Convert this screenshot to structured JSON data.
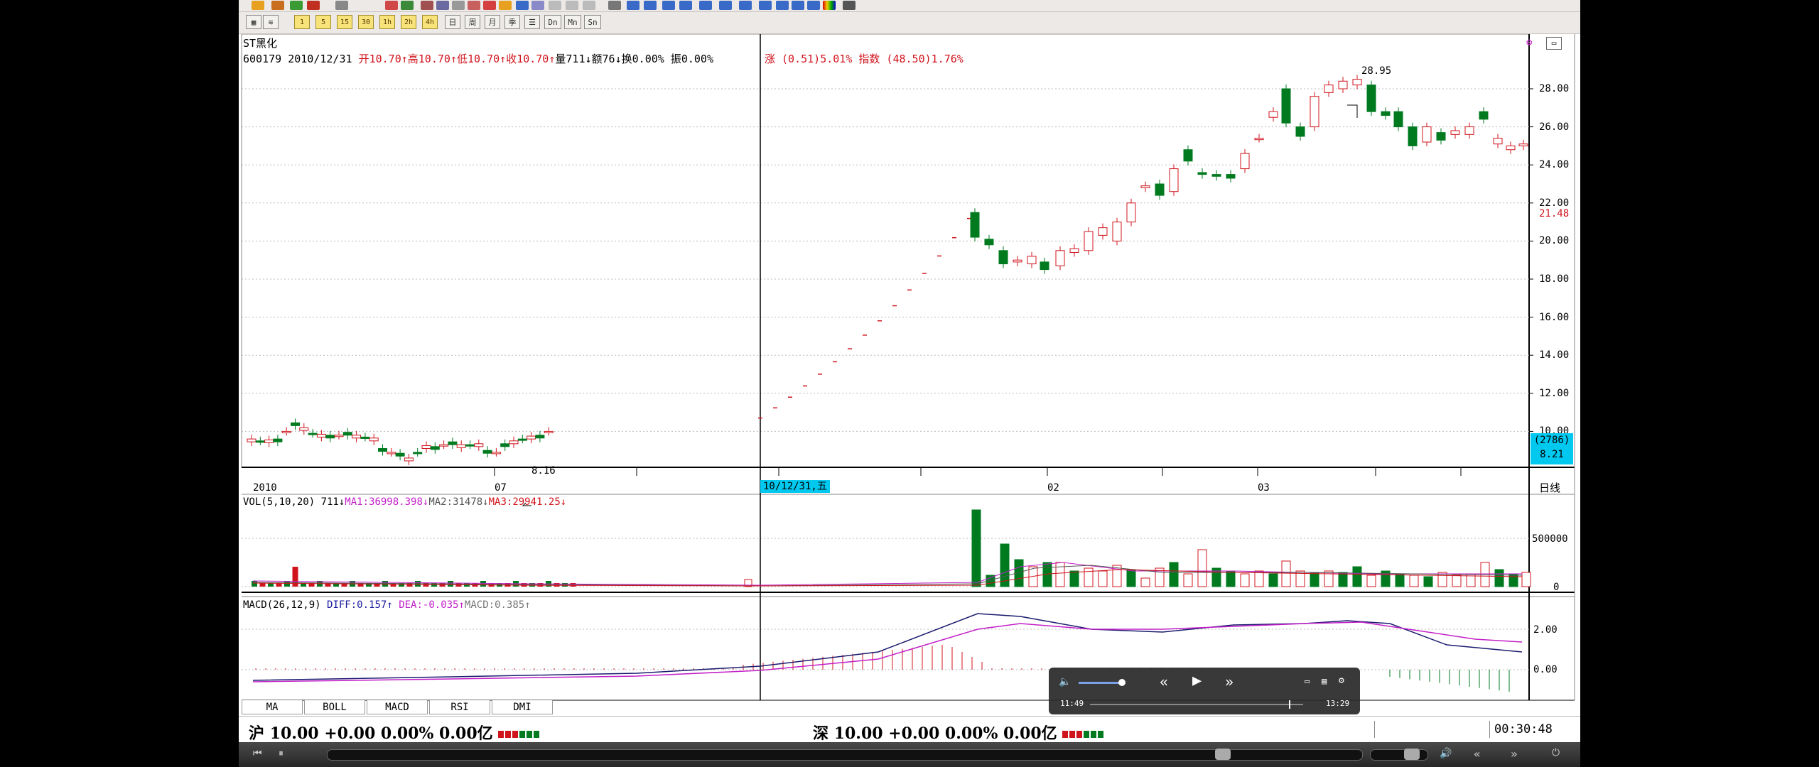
{
  "chart": {
    "stock_name": "ST黑化",
    "code_date": "600179 2010/12/31",
    "ohlc": {
      "open_label": "开",
      "open": "10.70",
      "high_label": "高",
      "high": "10.70",
      "low_label": "低",
      "low": "10.70",
      "close_label": "收",
      "close": "10.70",
      "vol_label": "量",
      "vol": "711",
      "amt_label": "额",
      "amt": "76",
      "turn_label": "换",
      "turn": "0.00%",
      "amp_label": "振",
      "amp": "0.00%"
    },
    "change": "涨 (0.51)5.01%",
    "index_change": "指数 (48.50)1.76%",
    "high_mark": "28.95",
    "low_mark": "8.16",
    "price_ticks": [
      "28.00",
      "26.00",
      "24.00",
      "22.00",
      "20.00",
      "18.00",
      "16.00",
      "14.00",
      "12.00",
      "10.00"
    ],
    "cursor_price": "21.48",
    "cursor_box": [
      "(2786)",
      "8.21"
    ],
    "date_ticks": [
      "2010",
      "07",
      "02",
      "03"
    ],
    "cursor_date": "10/12/31,五",
    "period": "日线",
    "vol_legend": {
      "head": "VOL(5,10,20) 711",
      "ma1": "MA1:36998.398",
      "ma2": "MA2:31478",
      "ma3": "MA3:29941.25"
    },
    "vol_ticks": [
      "500000",
      "0"
    ],
    "macd_legend": {
      "head": "MACD(26,12,9)",
      "diff": "DIFF:0.157",
      "dea": "DEA:-0.035",
      "macd": "MACD:0.385"
    },
    "macd_ticks": [
      "2.00",
      "0.00"
    ]
  },
  "indicator_tabs": [
    "MA",
    "BOLL",
    "MACD",
    "RSI",
    "DMI"
  ],
  "status": {
    "sh": {
      "name": "沪",
      "text": "10.00 +0.00 0.00% 0.00亿"
    },
    "sz": {
      "name": "深",
      "text": "10.00 +0.00 0.00% 0.00亿"
    },
    "time": "00:30:48"
  },
  "overlay": {
    "current": "11:49",
    "total": "13:29"
  },
  "colors": {
    "up": "#d0141c",
    "down": "#007a1f",
    "ma1": "#c21fc8",
    "ma2": "#555555",
    "ma3": "#d0141c",
    "diff": "#1a1a6e",
    "dea": "#c21fc8",
    "cursor_bg": "#00c8ef"
  }
}
